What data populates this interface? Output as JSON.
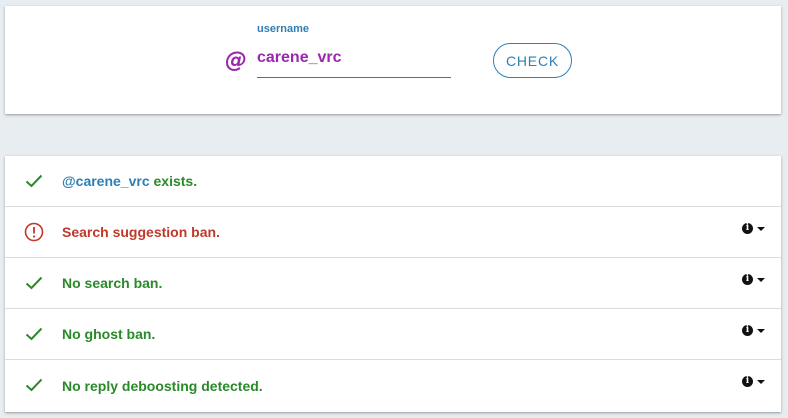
{
  "search": {
    "label": "username",
    "at_symbol": "@",
    "value": "carene_vrc",
    "button_label": "CHECK"
  },
  "colors": {
    "accent": "#2e7fb4",
    "handle": "#9b27af",
    "ok": "#2a8a2a",
    "warn": "#c0392b"
  },
  "results": {
    "exists": {
      "handle": "@carene_vrc",
      "text": " exists.",
      "icon": "check-icon",
      "status": "ok"
    },
    "items": [
      {
        "text": "Search suggestion ban.",
        "icon": "alert-circle-icon",
        "status": "warn"
      },
      {
        "text": "No search ban.",
        "icon": "check-icon",
        "status": "ok"
      },
      {
        "text": "No ghost ban.",
        "icon": "check-icon",
        "status": "ok"
      },
      {
        "text": "No reply deboosting detected.",
        "icon": "check-icon",
        "status": "ok"
      }
    ],
    "info_glyph": "i"
  }
}
